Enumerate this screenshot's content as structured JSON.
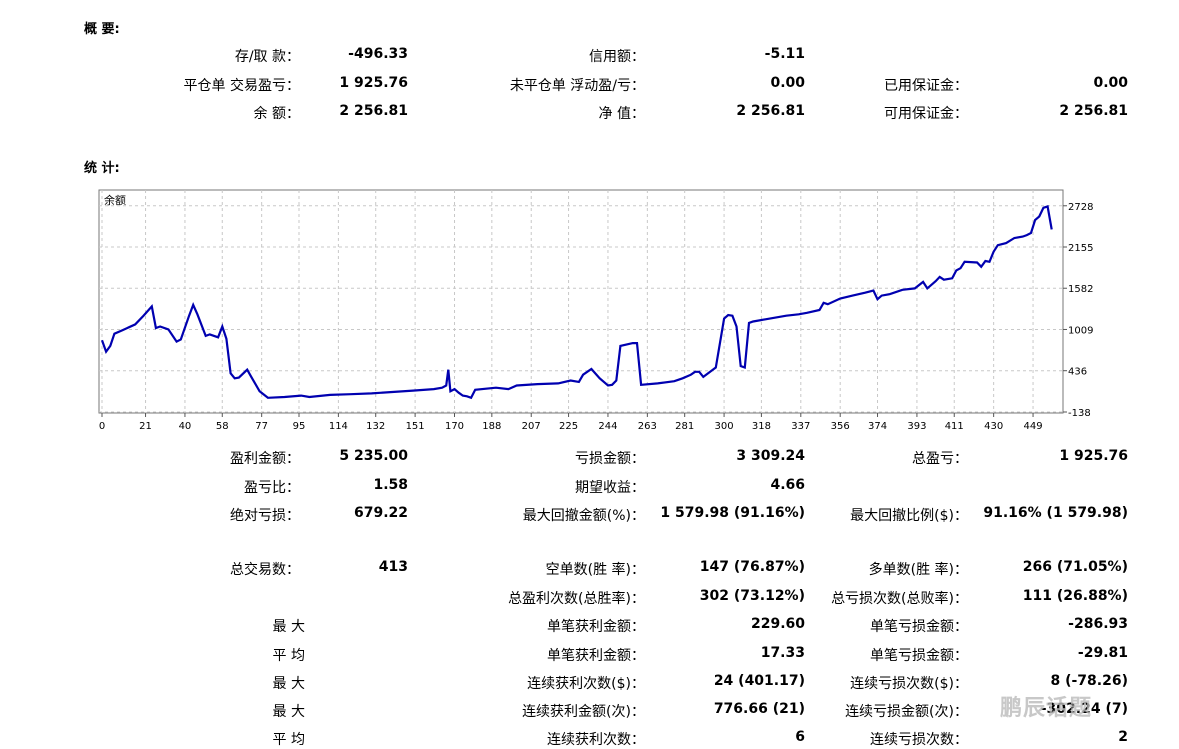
{
  "summary": {
    "title": "概 要:",
    "rows": [
      [
        {
          "label": "存/取 款：",
          "value": "-496.33"
        },
        {
          "label": "信用额：",
          "value": "-5.11"
        },
        {
          "label": "",
          "value": ""
        }
      ],
      [
        {
          "label": "平仓单 交易盈亏：",
          "value": "1 925.76"
        },
        {
          "label": "未平仓单 浮动盈/亏：",
          "value": "0.00"
        },
        {
          "label": "已用保证金：",
          "value": "0.00"
        }
      ],
      [
        {
          "label": "余 额：",
          "value": "2 256.81"
        },
        {
          "label": "净 值：",
          "value": "2 256.81"
        },
        {
          "label": "可用保证金：",
          "value": "2 256.81"
        }
      ]
    ]
  },
  "stats": {
    "title": "统 计:",
    "rows": [
      [
        {
          "label": "盈利金额：",
          "value": "5 235.00"
        },
        {
          "label": "亏损金额：",
          "value": "3 309.24"
        },
        {
          "label": "总盈亏：",
          "value": "1 925.76"
        }
      ],
      [
        {
          "label": "盈亏比：",
          "value": "1.58"
        },
        {
          "label": "期望收益：",
          "value": "4.66"
        },
        {
          "label": "",
          "value": ""
        }
      ],
      [
        {
          "label": "绝对亏损：",
          "value": "679.22"
        },
        {
          "label": "最大回撤金额(%)：",
          "value": "1 579.98 (91.16%)"
        },
        {
          "label": "最大回撤比例($)：",
          "value": "91.16% (1 579.98)"
        }
      ],
      [
        {
          "label": "总交易数：",
          "value": "413"
        },
        {
          "label": "空单数(胜 率)：",
          "value": "147 (76.87%)"
        },
        {
          "label": "多单数(胜 率)：",
          "value": "266 (71.05%)"
        }
      ],
      [
        {
          "label": "",
          "value": ""
        },
        {
          "label": "总盈利次数(总胜率)：",
          "value": "302 (73.12%)"
        },
        {
          "label": "总亏损次数(总败率)：",
          "value": "111 (26.88%)"
        }
      ],
      [
        {
          "label": "最 大",
          "value": ""
        },
        {
          "label": "单笔获利金额：",
          "value": "229.60"
        },
        {
          "label": "单笔亏损金额：",
          "value": "-286.93"
        }
      ],
      [
        {
          "label": "平 均",
          "value": ""
        },
        {
          "label": "单笔获利金额：",
          "value": "17.33"
        },
        {
          "label": "单笔亏损金额：",
          "value": "-29.81"
        }
      ],
      [
        {
          "label": "最 大",
          "value": ""
        },
        {
          "label": "连续获利次数($)：",
          "value": "24 (401.17)"
        },
        {
          "label": "连续亏损次数($)：",
          "value": "8 (-78.26)"
        }
      ],
      [
        {
          "label": "最 大",
          "value": ""
        },
        {
          "label": "连续获利金额(次)：",
          "value": "776.66 (21)"
        },
        {
          "label": "连续亏损金额(次)：",
          "value": "-302.24 (7)"
        }
      ],
      [
        {
          "label": "平 均",
          "value": ""
        },
        {
          "label": "连续获利次数：",
          "value": "6"
        },
        {
          "label": "连续亏损次数：",
          "value": "2"
        }
      ]
    ]
  },
  "chart_data": {
    "type": "line",
    "legend": "余额",
    "color": "#0000b0",
    "grid": true,
    "x_ticks": [
      0,
      21,
      40,
      58,
      77,
      95,
      114,
      132,
      151,
      170,
      188,
      207,
      225,
      244,
      263,
      281,
      300,
      318,
      337,
      356,
      374,
      393,
      411,
      430,
      449
    ],
    "y_ticks": [
      2728,
      2155,
      1582,
      1009,
      436,
      -138
    ],
    "xlim": [
      0,
      462
    ],
    "ylim": [
      -138,
      2850
    ],
    "series": [
      {
        "name": "余额",
        "x": [
          0,
          2,
          4,
          6,
          10,
          16,
          20,
          24,
          26,
          28,
          32,
          36,
          38,
          42,
          44,
          46,
          50,
          52,
          56,
          58,
          60,
          62,
          64,
          66,
          70,
          72,
          76,
          80,
          88,
          96,
          100,
          110,
          120,
          130,
          140,
          150,
          160,
          164,
          166,
          167,
          168,
          170,
          172,
          174,
          176,
          178,
          180,
          190,
          196,
          200,
          210,
          220,
          226,
          230,
          232,
          236,
          240,
          244,
          246,
          248,
          250,
          256,
          258,
          260,
          268,
          276,
          280,
          284,
          286,
          288,
          290,
          296,
          300,
          302,
          304,
          306,
          308,
          310,
          312,
          314,
          320,
          330,
          336,
          340,
          346,
          348,
          350,
          356,
          362,
          368,
          372,
          374,
          376,
          380,
          386,
          392,
          396,
          398,
          402,
          404,
          406,
          410,
          412,
          414,
          416,
          422,
          424,
          426,
          428,
          430,
          432,
          436,
          440,
          444,
          446,
          448,
          450,
          452,
          454,
          456,
          458
        ],
        "y": [
          860,
          700,
          780,
          950,
          1000,
          1080,
          1200,
          1330,
          1030,
          1050,
          1010,
          840,
          870,
          1200,
          1350,
          1220,
          920,
          940,
          900,
          1050,
          880,
          400,
          330,
          340,
          450,
          350,
          150,
          60,
          70,
          90,
          70,
          100,
          110,
          120,
          140,
          160,
          180,
          200,
          230,
          450,
          150,
          180,
          130,
          90,
          80,
          60,
          170,
          200,
          180,
          230,
          250,
          260,
          300,
          280,
          380,
          460,
          330,
          230,
          240,
          300,
          780,
          820,
          820,
          240,
          260,
          290,
          330,
          380,
          420,
          420,
          350,
          480,
          1160,
          1210,
          1200,
          1050,
          500,
          480,
          1100,
          1120,
          1150,
          1200,
          1220,
          1240,
          1280,
          1380,
          1360,
          1440,
          1480,
          1520,
          1550,
          1430,
          1480,
          1500,
          1560,
          1580,
          1670,
          1580,
          1680,
          1740,
          1700,
          1720,
          1830,
          1860,
          1950,
          1940,
          1880,
          1960,
          1950,
          2090,
          2180,
          2210,
          2280,
          2300,
          2320,
          2350,
          2530,
          2580,
          2700,
          2720,
          2400
        ]
      }
    ]
  },
  "watermark": "鹏辰话题"
}
